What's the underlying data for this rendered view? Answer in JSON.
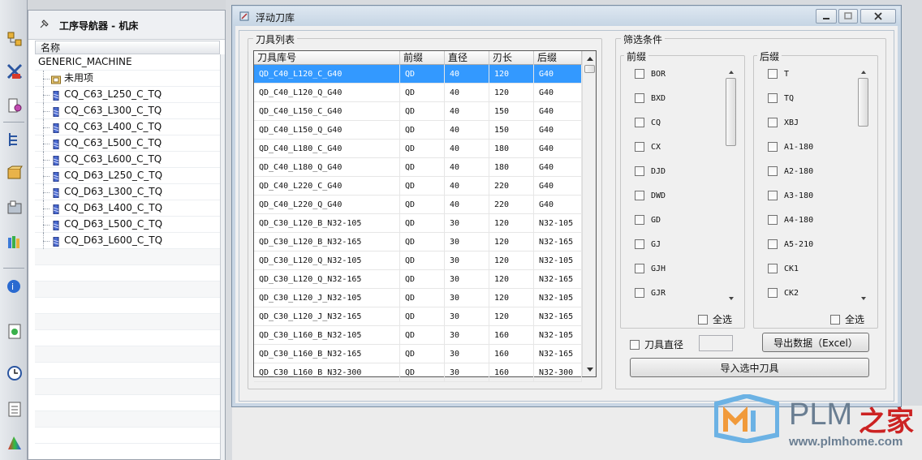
{
  "navigator": {
    "title": "工序导航器 - 机床",
    "column_header": "名称",
    "root": "GENERIC_MACHINE",
    "unused": "未用项",
    "tools": [
      "CQ_C63_L250_C_TQ",
      "CQ_C63_L300_C_TQ",
      "CQ_C63_L400_C_TQ",
      "CQ_C63_L500_C_TQ",
      "CQ_C63_L600_C_TQ",
      "CQ_D63_L250_C_TQ",
      "CQ_D63_L300_C_TQ",
      "CQ_D63_L400_C_TQ",
      "CQ_D63_L500_C_TQ",
      "CQ_D63_L600_C_TQ"
    ]
  },
  "dialog": {
    "title": "浮动刀库",
    "tool_list_group": "刀具列表",
    "filter_group": "筛选条件",
    "prefix_group": "前缀",
    "suffix_group": "后缀",
    "select_all": "全选",
    "tool_diameter_label": "刀具直径",
    "export_button": "导出数据（Excel）",
    "import_button": "导入选中刀具"
  },
  "tool_table": {
    "columns": [
      "刀具库号",
      "前缀",
      "直径",
      "刃长",
      "后缀"
    ],
    "rows": [
      [
        "QD_C40_L120_C_G40",
        "QD",
        "40",
        "120",
        "G40"
      ],
      [
        "QD_C40_L120_Q_G40",
        "QD",
        "40",
        "120",
        "G40"
      ],
      [
        "QD_C40_L150_C_G40",
        "QD",
        "40",
        "150",
        "G40"
      ],
      [
        "QD_C40_L150_Q_G40",
        "QD",
        "40",
        "150",
        "G40"
      ],
      [
        "QD_C40_L180_C_G40",
        "QD",
        "40",
        "180",
        "G40"
      ],
      [
        "QD_C40_L180_Q_G40",
        "QD",
        "40",
        "180",
        "G40"
      ],
      [
        "QD_C40_L220_C_G40",
        "QD",
        "40",
        "220",
        "G40"
      ],
      [
        "QD_C40_L220_Q_G40",
        "QD",
        "40",
        "220",
        "G40"
      ],
      [
        "QD_C30_L120_B_N32-105",
        "QD",
        "30",
        "120",
        "N32-105"
      ],
      [
        "QD_C30_L120_B_N32-165",
        "QD",
        "30",
        "120",
        "N32-165"
      ],
      [
        "QD_C30_L120_Q_N32-105",
        "QD",
        "30",
        "120",
        "N32-105"
      ],
      [
        "QD_C30_L120_Q_N32-165",
        "QD",
        "30",
        "120",
        "N32-165"
      ],
      [
        "QD_C30_L120_J_N32-105",
        "QD",
        "30",
        "120",
        "N32-105"
      ],
      [
        "QD_C30_L120_J_N32-165",
        "QD",
        "30",
        "120",
        "N32-165"
      ],
      [
        "QD_C30_L160_B_N32-105",
        "QD",
        "30",
        "160",
        "N32-105"
      ],
      [
        "QD_C30_L160_B_N32-165",
        "QD",
        "30",
        "160",
        "N32-165"
      ],
      [
        "QD_C30_L160_B_N32-300",
        "QD",
        "30",
        "160",
        "N32-300"
      ]
    ],
    "selected_row": 0
  },
  "prefix_options": [
    "BOR",
    "BXD",
    "CQ",
    "CX",
    "DJD",
    "DWD",
    "GD",
    "GJ",
    "GJH",
    "GJR"
  ],
  "suffix_options": [
    "T",
    "TQ",
    "XBJ",
    "A1-180",
    "A2-180",
    "A3-180",
    "A4-180",
    "A5-210",
    "CK1",
    "CK2"
  ],
  "watermark": {
    "brand": "PLM",
    "brand_suffix": "之家",
    "url": "www.plmhome.com"
  },
  "colors": {
    "selection": "#3399ff",
    "brand_grey": "#6a7e92",
    "brand_red": "#cc2222"
  }
}
